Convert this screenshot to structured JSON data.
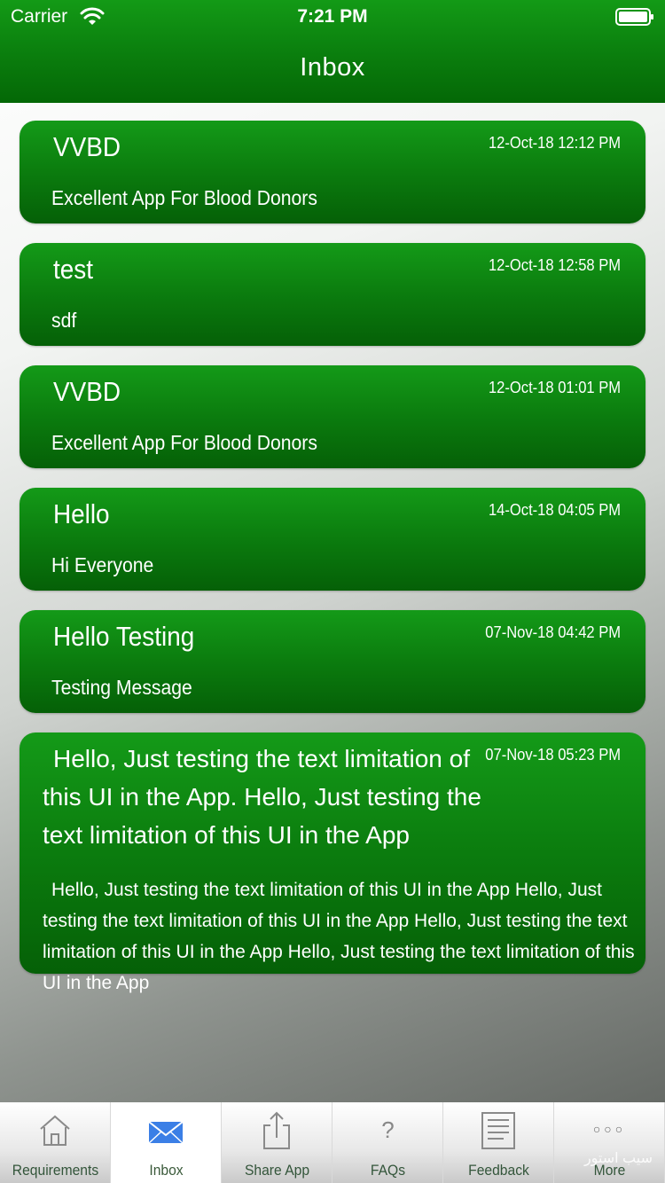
{
  "status_bar": {
    "carrier": "Carrier",
    "time": "7:21 PM"
  },
  "nav": {
    "title": "Inbox"
  },
  "messages": [
    {
      "title": "VVBD",
      "date": "12-Oct-18 12:12 PM",
      "body": "Excellent App For Blood Donors"
    },
    {
      "title": "test",
      "date": "12-Oct-18 12:58 PM",
      "body": "sdf"
    },
    {
      "title": "VVBD",
      "date": "12-Oct-18 01:01 PM",
      "body": "Excellent App For Blood Donors"
    },
    {
      "title": "Hello",
      "date": "14-Oct-18 04:05 PM",
      "body": "Hi Everyone"
    },
    {
      "title": "Hello Testing",
      "date": "07-Nov-18 04:42 PM",
      "body": "Testing Message"
    },
    {
      "title": "Hello, Just testing the text limitation of this UI in the App. Hello, Just testing the text limitation of this UI in the App",
      "date": "07-Nov-18 05:23 PM",
      "body": "Hello, Just testing the text limitation of this UI in the App Hello, Just testing the text limitation of this UI in the App Hello, Just testing the text limitation of this UI in the App Hello, Just testing the text limitation of this UI in the App"
    }
  ],
  "tabs": [
    {
      "label": "Requirements",
      "icon": "home-icon"
    },
    {
      "label": "Inbox",
      "icon": "envelope-icon"
    },
    {
      "label": "Share App",
      "icon": "share-icon"
    },
    {
      "label": "FAQs",
      "icon": "question-icon"
    },
    {
      "label": "Feedback",
      "icon": "document-icon"
    },
    {
      "label": "More",
      "icon": "more-dots-icon"
    }
  ],
  "tab_glyphs": {
    "faq": "?",
    "more": "○○○"
  },
  "watermark": "سیب‌ استور",
  "colors": {
    "bar_green": "#0a7d0d",
    "card_green": "#0b7c0e",
    "active_tab_icon": "#3b7fe6"
  }
}
